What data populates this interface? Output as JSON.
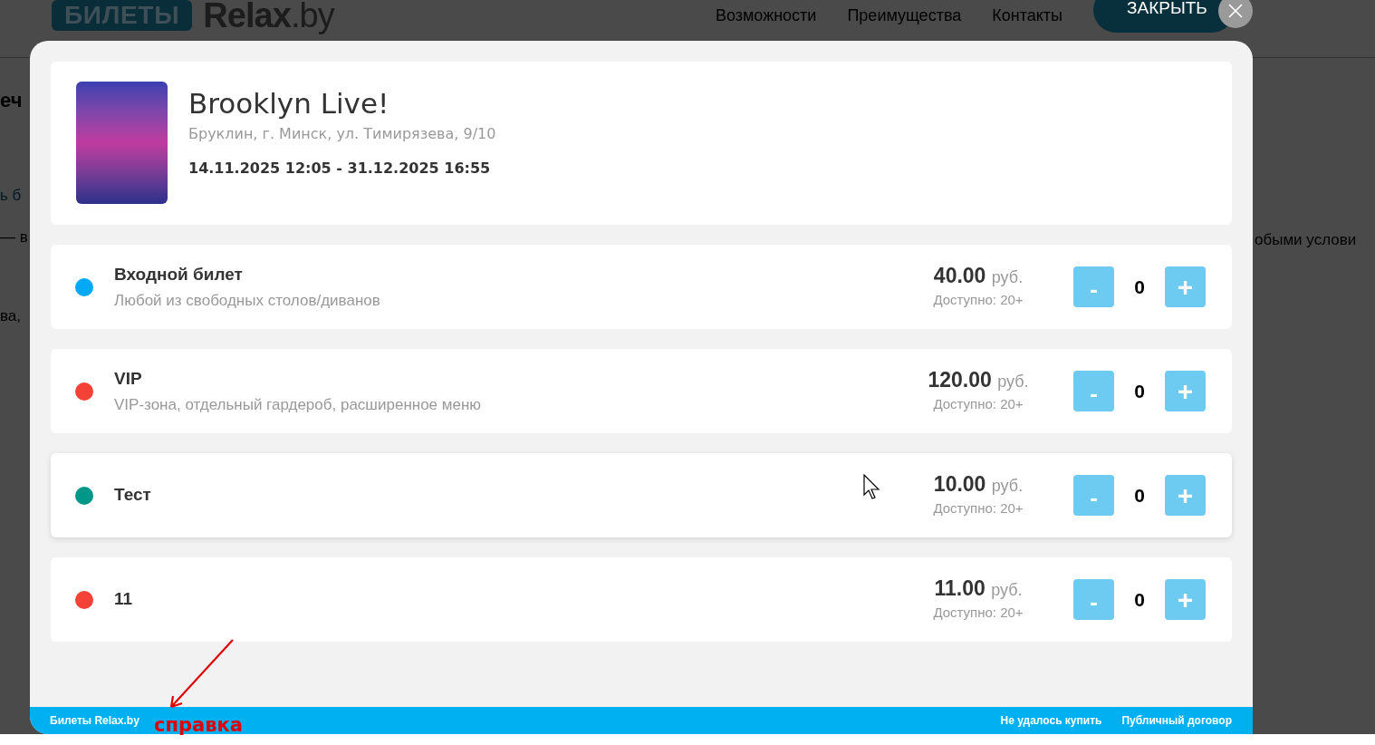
{
  "background_page": {
    "logo": {
      "badge": "БИЛЕТЫ",
      "name": "Relax",
      "suffix": ".by"
    },
    "nav": [
      "Возможности",
      "Преимущества",
      "Контакты"
    ],
    "left_fragments": [
      "еч",
      "ь б",
      "— в",
      "ва,"
    ],
    "right_fragments": [
      "обыми услови"
    ]
  },
  "close": {
    "label": "ЗАКРЫТЬ"
  },
  "event": {
    "title": "Brooklyn Live!",
    "venue": "Бруклин, г. Минск, ул. Тимирязева, 9/10",
    "dates": "14.11.2025 12:05 - 31.12.2025 16:55"
  },
  "tickets": [
    {
      "name": "Входной билет",
      "description": "Любой из свободных столов/диванов",
      "color": "#03a9f4",
      "price": "40.00",
      "currency": "руб.",
      "availability": "Доступно: 20+",
      "minus": "-",
      "count": "0",
      "plus": "+"
    },
    {
      "name": "VIP",
      "description": "VIP-зона, отдельный гардероб, расширенное меню",
      "color": "#f44336",
      "price": "120.00",
      "currency": "руб.",
      "availability": "Доступно: 20+",
      "minus": "-",
      "count": "0",
      "plus": "+"
    },
    {
      "name": "Тест",
      "color": "#009688",
      "price": "10.00",
      "currency": "руб.",
      "availability": "Доступно: 20+",
      "minus": "-",
      "count": "0",
      "plus": "+"
    },
    {
      "name": "11",
      "color": "#f44336",
      "price": "11.00",
      "currency": "руб.",
      "availability": "Доступно: 20+",
      "minus": "-",
      "count": "0",
      "plus": "+"
    }
  ],
  "footer": {
    "brand": "Билеты Relax.by",
    "links": [
      "Не удалось купить",
      "Публичный договор"
    ]
  },
  "annotation": {
    "text": "справка"
  }
}
